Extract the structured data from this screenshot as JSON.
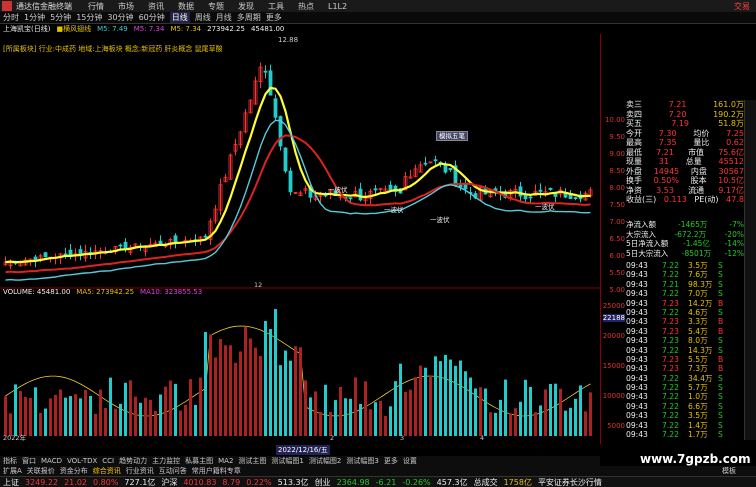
{
  "menu": {
    "app_title": "通达信金融终端",
    "items": [
      "行情",
      "市场",
      "资讯",
      "数据",
      "专题",
      "发现",
      "工具",
      "热点",
      "L1L2"
    ],
    "trade": "交易"
  },
  "toolbar": [
    "分时",
    "1分钟",
    "5分钟",
    "15分钟",
    "30分钟",
    "60分钟",
    "日线",
    "周线",
    "月线",
    "多周期",
    "更多"
  ],
  "toolbar_active": 6,
  "info": {
    "stock": "上海凯宝(日线)",
    "pattern": "■横风翅线",
    "ma1": "M5: 7.49",
    "ma2": "M5: 7.34",
    "ma3": "M5: 7.34",
    "val1": "273942.25",
    "val2": "45481.00"
  },
  "sector_line": "[所属板块] 行业:中成药 地域:上海板块 概念:新冠药 肝炎概念 鼠尾草酸",
  "peak_label": "12.88",
  "vol_line": {
    "volume": "VOLUME: 45481.00",
    "ma5": "MA5: 273942.25",
    "ma10": "MA10: 323855.53"
  },
  "right_axis_price": [
    "10.00",
    "9.50",
    "9.00",
    "8.50",
    "8.00",
    "7.50",
    "7.00",
    "6.50",
    "6.00",
    "5.50",
    "5.00"
  ],
  "right_axis_volume": [
    "25000",
    "20000",
    "15000",
    "10000",
    "5000"
  ],
  "volume_marker": "22188",
  "quote": [
    {
      "k": "卖三",
      "v": "7.21",
      "v2": "161.0万"
    },
    {
      "k": "卖四",
      "v": "7.20",
      "v2": "190.2万"
    },
    {
      "k": "买五",
      "v": "7.19",
      "v2": "51.8万"
    },
    {
      "k": "今开",
      "v": "7.30",
      "v2": "均价",
      "v3": "7.25"
    },
    {
      "k": "最高",
      "v": "7.35",
      "v2": "量比",
      "v3": "0.62"
    },
    {
      "k": "最低",
      "v": "7.21",
      "v2": "市值",
      "v3": "75.6亿"
    },
    {
      "k": "现量",
      "v": "31",
      "v2": "总量",
      "v3": "45512"
    },
    {
      "k": "外盘",
      "v": "14945",
      "v2": "内盘",
      "v3": "30567"
    },
    {
      "k": "换手",
      "v": "0.50%",
      "v2": "股本",
      "v3": "10.5亿"
    },
    {
      "k": "净资",
      "v": "3.53",
      "v2": "流通",
      "v3": "9.17亿"
    },
    {
      "k": "收益(三)",
      "v": "0.113",
      "v2": "PE(动)",
      "v3": "47.8"
    }
  ],
  "flow": [
    {
      "k": "净流入额",
      "v": "-1465万",
      "p": "-7%"
    },
    {
      "k": "大宗流入",
      "v": "-672.2万",
      "p": "-20%"
    },
    {
      "k": "5日净流入额",
      "v": "-1.45亿",
      "p": "-14%"
    },
    {
      "k": "5日大宗流入",
      "v": "-8501万",
      "p": "-12%"
    }
  ],
  "ticks": [
    {
      "t": "09:43",
      "p": "7.22",
      "v": "3.5万",
      "s": "S"
    },
    {
      "t": "09:43",
      "p": "7.22",
      "v": "7.6万",
      "s": "S"
    },
    {
      "t": "09:43",
      "p": "7.21",
      "v": "98.3万",
      "s": "S"
    },
    {
      "t": "09:43",
      "p": "7.22",
      "v": "7.0万",
      "s": "S"
    },
    {
      "t": "09:43",
      "p": "7.23",
      "v": "14.2万",
      "s": "B"
    },
    {
      "t": "09:43",
      "p": "7.22",
      "v": "4.6万",
      "s": "S"
    },
    {
      "t": "09:43",
      "p": "7.23",
      "v": "3.3万",
      "s": "B"
    },
    {
      "t": "09:43",
      "p": "7.23",
      "v": "5.4万",
      "s": "B"
    },
    {
      "t": "09:43",
      "p": "7.23",
      "v": "8.0万",
      "s": "S"
    },
    {
      "t": "09:43",
      "p": "7.22",
      "v": "14.3万",
      "s": "S"
    },
    {
      "t": "09:43",
      "p": "7.23",
      "v": "5.5万",
      "s": "B"
    },
    {
      "t": "09:43",
      "p": "7.23",
      "v": "7.3万",
      "s": "B"
    },
    {
      "t": "09:43",
      "p": "7.22",
      "v": "34.4万",
      "s": "S"
    },
    {
      "t": "09:43",
      "p": "7.22",
      "v": "5.7万",
      "s": "S"
    },
    {
      "t": "09:43",
      "p": "7.22",
      "v": "1.0万",
      "s": "S"
    },
    {
      "t": "09:43",
      "p": "7.22",
      "v": "6.6万",
      "s": "S"
    },
    {
      "t": "09:43",
      "p": "7.22",
      "v": "3.5万",
      "s": "S"
    },
    {
      "t": "09:43",
      "p": "7.22",
      "v": "1.4万",
      "s": "S"
    },
    {
      "t": "09:43",
      "p": "7.22",
      "v": "1.7万",
      "s": "S"
    }
  ],
  "date_label": "2022/12/16/五",
  "year_label": "2022年",
  "axis_months": [
    "12",
    "2",
    "3",
    "4"
  ],
  "signals": [
    "一波伏",
    "一波伏",
    "一波伏",
    "一波伏"
  ],
  "sig_button": "模拟五笔",
  "indicator_tabs": [
    "指标",
    "窗口",
    "MACD",
    "VOL-TDX",
    "CCI",
    "趋势动力",
    "主力监控",
    "私募主图",
    "MA2",
    "测试主图",
    "测试幅图1",
    "测试幅图2",
    "测试幅图3",
    "更多",
    "设置"
  ],
  "bottom_tabs": [
    "扩展A",
    "关联报价",
    "资金分布",
    "综合资讯",
    "行业资讯",
    "互动问答",
    "常用户籍料专章"
  ],
  "bottom_right": "模板",
  "status": {
    "sh_label": "上证",
    "sh_val": "3249.22",
    "sh_chg": "21.02",
    "sh_pct": "0.80%",
    "sh_amt": "727.1亿",
    "hs_label": "沪深",
    "hs_val": "4010.83",
    "hs_chg": "8.79",
    "hs_pct": "0.22%",
    "hs_amt": "513.3亿",
    "cy_label": "创业",
    "cy_val": "2364.98",
    "cy_chg": "-6.21",
    "cy_pct": "-0.26%",
    "cy_amt": "457.3亿",
    "zc_label": "总成交",
    "zc_val": "1758亿",
    "broker": "平安证券长沙行情"
  },
  "watermark": "www.7gpzb.com",
  "chart_data": {
    "type": "candlestick",
    "title": "上海凯宝(日线)",
    "price_axis": [
      5.0,
      10.0
    ],
    "price_scale_labels": [
      10.0,
      9.5,
      9.0,
      8.5,
      8.0,
      7.5,
      7.0,
      6.5,
      6.0,
      5.5,
      5.0
    ],
    "peak": 12.88,
    "volume_axis": [
      0,
      25000
    ],
    "volume_scale_labels": [
      25000,
      20000,
      15000,
      10000,
      5000
    ],
    "last_volume": 45481.0,
    "ma5_volume": 273942.25,
    "ma10_volume": 323855.53
  }
}
